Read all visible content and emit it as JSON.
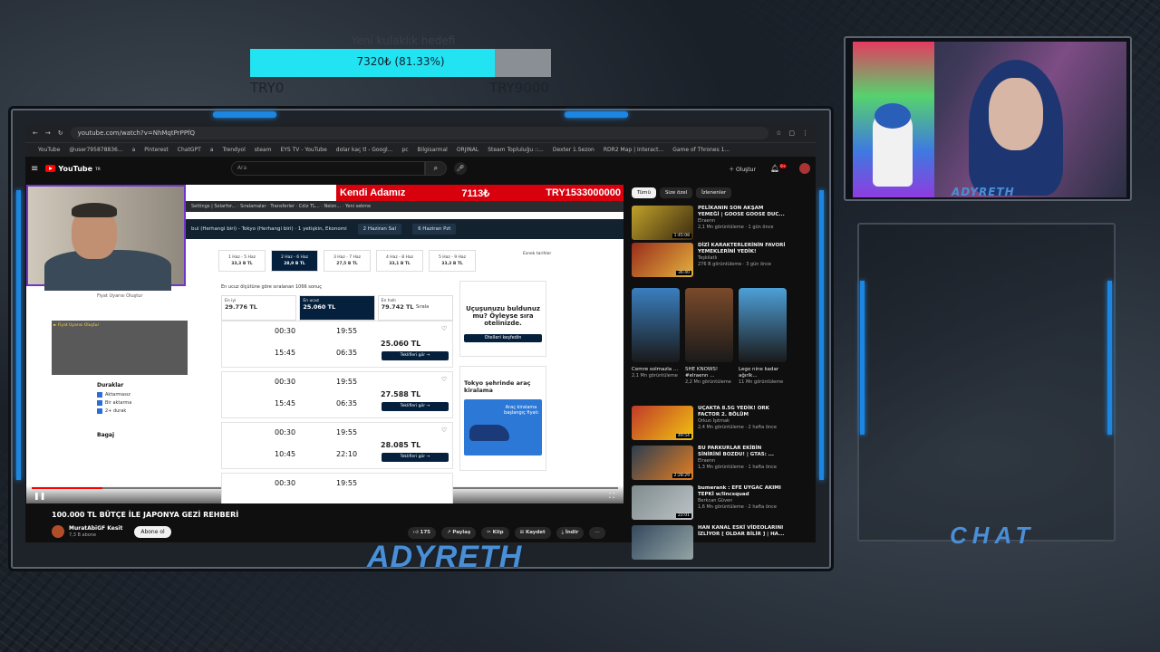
{
  "goal": {
    "title": "Yeni kulaklık hedefi",
    "progress_text": "7320₺ (81.33%)",
    "fraction": 0.8133,
    "min_label": "TRY0",
    "max_label": "TRY9000"
  },
  "browser": {
    "url": "youtube.com/watch?v=NhMqtPrPPfQ",
    "bookmarks": [
      "YouTube",
      "@user795878836...",
      "a",
      "Pinterest",
      "ChatGPT",
      "a",
      "Trendyol",
      "steam",
      "EYS TV - YouTube",
      "dolar kaç tl - Googl...",
      "pc",
      "Bilgisarmal",
      "ORJINAL",
      "Steam Topluluğu ::...",
      "Dexter 1.Sezon",
      "RDR2 Map | Interact...",
      "Game of Thrones 1..."
    ]
  },
  "youtube": {
    "logo": "YouTube",
    "logo_region": "TR",
    "search_placeholder": "Ara",
    "create_label": "Oluştur",
    "notif_count": "9+"
  },
  "video": {
    "banner_name": "Kendi Adamız",
    "banner_price": "7113₺",
    "banner_total": "TRY1533000000",
    "route_text": "bul (Herhangi biri) - Tokyo (Herhangi biri) · 1 yetişkin, Ekonomi",
    "route_date1": "2 Haziran Sal",
    "route_date2": "6 Haziran Pzt",
    "dates": [
      {
        "d": "1 Haz - 5 Haz",
        "p": "33,3 B TL"
      },
      {
        "d": "2 Haz - 6 Haz",
        "p": "28,9 B TL"
      },
      {
        "d": "3 Haz - 7 Haz",
        "p": "27,5 B TL"
      },
      {
        "d": "4 Haz - 8 Haz",
        "p": "33,1 B TL"
      },
      {
        "d": "5 Haz - 9 Haz",
        "p": "33,3 B TL"
      }
    ],
    "flex_label": "Esnek tarihler",
    "results_text": "En ucuz ölçütüne göre sıralanan 1066 sonuç",
    "sort": [
      {
        "l": "En iyi",
        "v": "29.776 TL"
      },
      {
        "l": "En ucuz",
        "v": "25.060 TL"
      },
      {
        "l": "En hızlı",
        "v": "79.742 TL"
      }
    ],
    "sort_label": "Sırala",
    "flights": [
      {
        "dep": "00:30",
        "arr": "19:55",
        "dep2": "15:45",
        "arr2": "06:35",
        "price": "25.060 TL"
      },
      {
        "dep": "00:30",
        "arr": "19:55",
        "dep2": "15:45",
        "arr2": "06:35",
        "price": "27.588 TL"
      },
      {
        "dep": "00:30",
        "arr": "19:55",
        "dep2": "10:45",
        "arr2": "22:10",
        "price": "28.085 TL"
      },
      {
        "dep": "00:30",
        "arr": "19:55"
      }
    ],
    "offer_btn": "Teklifleri gör →",
    "ad1_title": "Uçuşunuzu buldunuz mu? Öyleyse sıra otelinizde.",
    "ad1_btn": "Otelleri keşfedin",
    "ad2_title": "Tokyo şehrinde araç kiralama",
    "ad2_car_text": "Araç kiralama başlangıç fiyatı",
    "filter_title": "Duraklar",
    "filters": [
      "Aktarmasız",
      "Bir aktarma",
      "2+ durak"
    ],
    "bag_title": "Bagaj",
    "price_alert": "Fiyat Uyarısı Oluştur",
    "progress": 0.12
  },
  "meta": {
    "title": "100.000 TL BÜTÇE İLE JAPONYA GEZİ REHBERİ",
    "channel": "MuratAbiGF Kesit",
    "subs": "7,3 B abone",
    "subscribe": "Abone ol",
    "likes": "175",
    "share": "Paylaş",
    "clip": "Klip",
    "save": "Kaydet",
    "download": "İndir"
  },
  "sidebar": {
    "chips": [
      "Tümü",
      "Size özel",
      "İzlenenler"
    ],
    "recs": [
      {
        "title": "PELİKANIN SON AKŞAM YEMEĞİ | GOOSE GOOSE DUC...",
        "ch": "Elraenn",
        "stats": "2,1 Mn görüntüleme · 1 gün önce",
        "dur": "1:45:08",
        "c1": "#c0a12a",
        "c2": "#3a2a10"
      },
      {
        "title": "DİZİ KARAKTERLERİNİN FAVORİ YEMEKLERİNİ YEDİK!",
        "ch": "Teşkilatlı",
        "stats": "276 B görüntüleme · 3 gün önce",
        "dur": "36:40",
        "c1": "#9a2c1d",
        "c2": "#e3b23c"
      }
    ],
    "shorts": [
      {
        "t": "Cemre solmazla ...",
        "v": "2,1 Mn görüntüleme",
        "c": "#3a7fbf"
      },
      {
        "t": "SHE KNOWS! #elraenn ...",
        "v": "2,2 Mn görüntüleme",
        "c": "#7a4a2a"
      },
      {
        "t": "Lego nine kadar ağırlk...",
        "v": "11 Mn görüntüleme",
        "c": "#4da0d8"
      }
    ],
    "recs2": [
      {
        "title": "UÇAKTA 8.5G YEDİK! ORK FACTOR 2. BÖLÜM",
        "ch": "Orkun Işıtmak",
        "stats": "2,4 Mn görüntüleme · 2 hafta önce",
        "dur": "49:54",
        "c1": "#c0392b",
        "c2": "#f1c40f"
      },
      {
        "title": "BU PARKURLAR EKİBİN SİNİRİNİ BOZDU! | GTA5: ...",
        "ch": "Elraenn",
        "stats": "1,3 Mn görüntüleme · 1 hafta önce",
        "dur": "2:28:29",
        "c1": "#2c3e50",
        "c2": "#e67e22"
      },
      {
        "title": "bumerank : EFE UYGAC AKIMI TEPKİ w/lincsquad",
        "ch": "Berkcan Güven",
        "stats": "1,6 Mn görüntüleme · 2 hafta önce",
        "dur": "22:01",
        "c1": "#7f8c8d",
        "c2": "#bdc3c7"
      },
      {
        "title": "HAN KANAL ESKİ VİDEOLARINI İZLİYOR [ OLDAR BİLİR ] | HA...",
        "ch": "",
        "stats": "",
        "dur": "",
        "c1": "#34495e",
        "c2": "#95a5a6"
      }
    ]
  },
  "stream": {
    "brand": "ADYRETH",
    "cam_name": "ADYRETH",
    "chat_label": "CHAT",
    "accent": "#4a8fd6"
  }
}
